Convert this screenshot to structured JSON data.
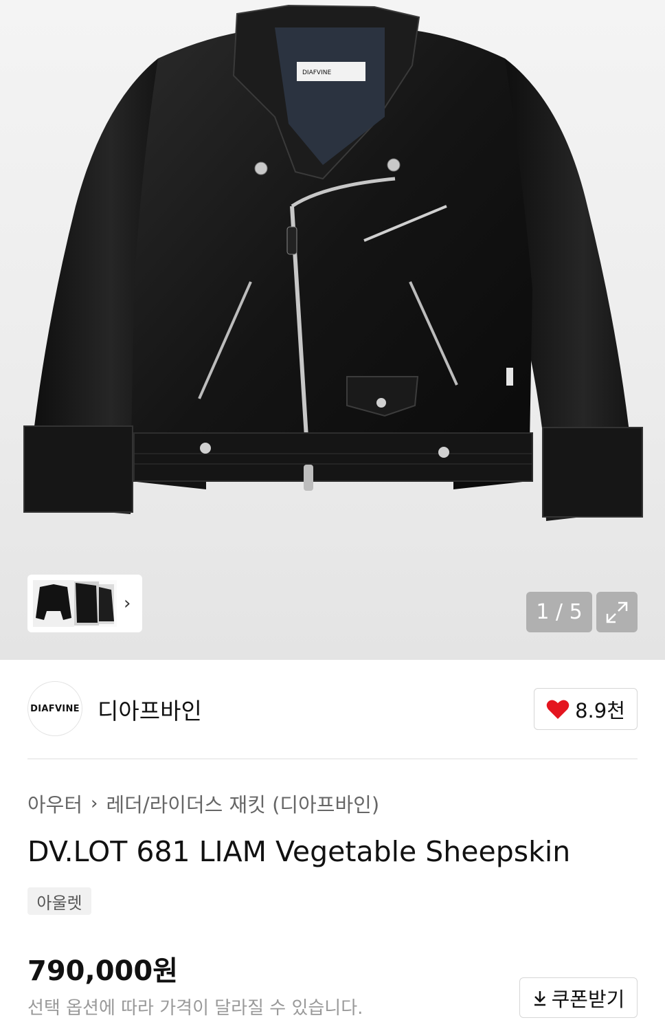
{
  "gallery": {
    "counter": "1 / 5",
    "icons": {
      "next": "chevron-right-icon",
      "expand": "expand-icon"
    }
  },
  "brand": {
    "logo_text": "DIAFVINE",
    "name": "디아프바인",
    "like_count": "8.9천",
    "like_icon": "heart-icon",
    "like_color": "#e4151f"
  },
  "breadcrumb": {
    "level1": "아우터",
    "level2": "레더/라이더스 재킷 (디아프바인)"
  },
  "product": {
    "title": "DV.LOT 681 LIAM Vegetable Sheepskin",
    "tag": "아울렛",
    "price": "790,000원",
    "price_note": "선택 옵션에 따라 가격이 달라질 수 있습니다.",
    "coupon_label": "쿠폰받기",
    "coupon_icon": "download-icon"
  }
}
